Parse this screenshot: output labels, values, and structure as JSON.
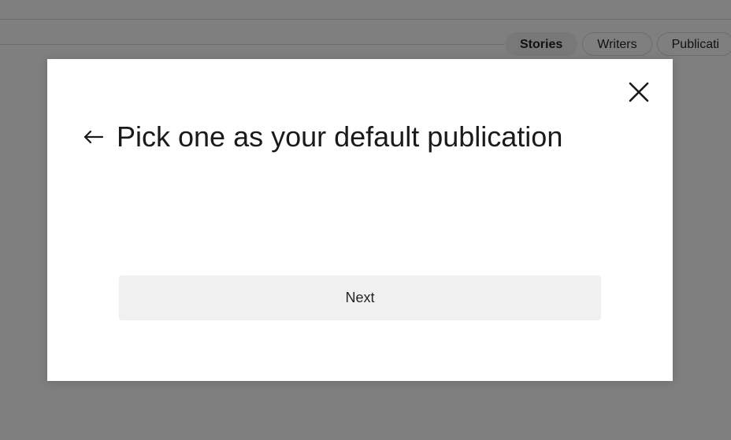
{
  "background": {
    "tabs": [
      {
        "label": "Stories",
        "active": true
      },
      {
        "label": "Writers",
        "active": false
      },
      {
        "label": "Publicati",
        "active": false
      }
    ]
  },
  "modal": {
    "title": "Pick one as your default publication",
    "back_icon": "arrow-left-icon",
    "close_icon": "close-icon",
    "next_label": "Next"
  },
  "colors": {
    "overlay": "#808080",
    "button_bg": "#f0f0f0",
    "text": "#1a1a1a"
  }
}
